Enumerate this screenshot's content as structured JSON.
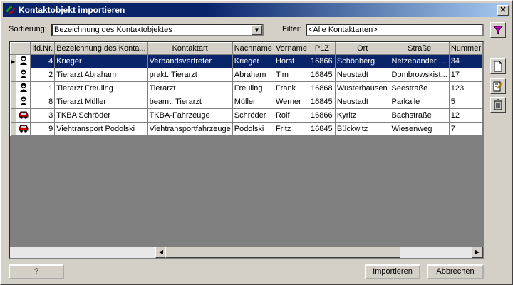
{
  "window": {
    "title": "Kontaktobjekt importieren",
    "close_label": "✕"
  },
  "toolbar": {
    "sort_label": "Sortierung:",
    "sort_value": "Bezeichnung des Kontaktobjektes",
    "filter_label": "Filter:",
    "filter_value": "<Alle Kontaktarten>"
  },
  "grid": {
    "columns": [
      "lfd.Nr.",
      "Bezeichnung des Konta...",
      "Kontaktart",
      "Nachname",
      "Vorname",
      "PLZ",
      "Ort",
      "Straße",
      "Nummer"
    ],
    "rows": [
      {
        "icon": "person-icon",
        "nr": "4",
        "bez": "Krieger",
        "art": "Verbandsvertreter",
        "nach": "Krieger",
        "vor": "Horst",
        "plz": "16866",
        "ort": "Schönberg",
        "str": "Netzebander ...",
        "num": "34"
      },
      {
        "icon": "person-icon",
        "nr": "2",
        "bez": "Tierarzt Abraham",
        "art": "prakt. Tierarzt",
        "nach": "Abraham",
        "vor": "Tim",
        "plz": "16845",
        "ort": "Neustadt",
        "str": "Dombrowskist...",
        "num": "17"
      },
      {
        "icon": "person-icon",
        "nr": "1",
        "bez": "Tierarzt Freuling",
        "art": "Tierarzt",
        "nach": "Freuling",
        "vor": "Frank",
        "plz": "16868",
        "ort": "Wusterhausen",
        "str": "Seestraße",
        "num": "123"
      },
      {
        "icon": "person-icon",
        "nr": "8",
        "bez": "Tierarzt Müller",
        "art": "beamt. Tierarzt",
        "nach": "Müller",
        "vor": "Werner",
        "plz": "16845",
        "ort": "Neustadt",
        "str": "Parkalle",
        "num": "5"
      },
      {
        "icon": "car-icon",
        "nr": "3",
        "bez": "TKBA Schröder",
        "art": "TKBA-Fahrzeuge",
        "nach": "Schröder",
        "vor": "Rolf",
        "plz": "16866",
        "ort": "Kyritz",
        "str": "Bachstraße",
        "num": "12"
      },
      {
        "icon": "car-icon",
        "nr": "9",
        "bez": "Viehtransport Podolski",
        "art": "Viehtransportfahrzeuge",
        "nach": "Podolski",
        "vor": "Fritz",
        "plz": "16845",
        "ort": "Bückwitz",
        "str": "Wiesenweg",
        "num": "7"
      }
    ]
  },
  "buttons": {
    "help": "?",
    "import": "Importieren",
    "cancel": "Abbrechen"
  }
}
